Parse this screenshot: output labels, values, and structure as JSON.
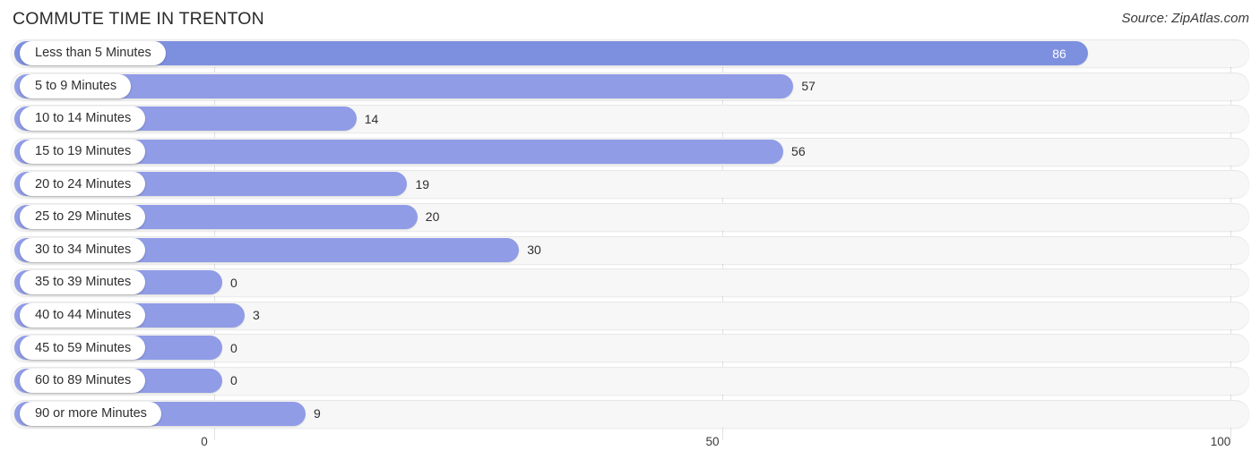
{
  "header": {
    "title": "COMMUTE TIME IN TRENTON",
    "source": "Source: ZipAtlas.com"
  },
  "colors": {
    "bar": "#909ce6",
    "bar_accent": "#7d8fdf",
    "track": "#f7f7f7",
    "gridline": "#e2e2e2",
    "text": "#2f2f2f"
  },
  "chart_data": {
    "type": "bar",
    "orientation": "horizontal",
    "title": "COMMUTE TIME IN TRENTON",
    "xlabel": "",
    "ylabel": "",
    "xlim": [
      0,
      100
    ],
    "ticks": [
      "0",
      "50",
      "100"
    ],
    "tick_values": [
      0,
      50,
      100
    ],
    "grid": true,
    "legend": null,
    "categories": [
      "Less than 5 Minutes",
      "5 to 9 Minutes",
      "10 to 14 Minutes",
      "15 to 19 Minutes",
      "20 to 24 Minutes",
      "25 to 29 Minutes",
      "30 to 34 Minutes",
      "35 to 39 Minutes",
      "40 to 44 Minutes",
      "45 to 59 Minutes",
      "60 to 89 Minutes",
      "90 or more Minutes"
    ],
    "values": [
      86,
      57,
      14,
      56,
      19,
      20,
      30,
      0,
      3,
      0,
      0,
      9
    ],
    "value_labels": [
      "86",
      "57",
      "14",
      "56",
      "19",
      "20",
      "30",
      "0",
      "3",
      "0",
      "0",
      "9"
    ]
  },
  "rows": [
    {
      "label": "Less than 5 Minutes",
      "value": 86,
      "value_label": "86",
      "inside": true
    },
    {
      "label": "5 to 9 Minutes",
      "value": 57,
      "value_label": "57",
      "inside": false
    },
    {
      "label": "10 to 14 Minutes",
      "value": 14,
      "value_label": "14",
      "inside": false
    },
    {
      "label": "15 to 19 Minutes",
      "value": 56,
      "value_label": "56",
      "inside": false
    },
    {
      "label": "20 to 24 Minutes",
      "value": 19,
      "value_label": "19",
      "inside": false
    },
    {
      "label": "25 to 29 Minutes",
      "value": 20,
      "value_label": "20",
      "inside": false
    },
    {
      "label": "30 to 34 Minutes",
      "value": 30,
      "value_label": "30",
      "inside": false
    },
    {
      "label": "35 to 39 Minutes",
      "value": 0,
      "value_label": "0",
      "inside": false
    },
    {
      "label": "40 to 44 Minutes",
      "value": 3,
      "value_label": "3",
      "inside": false
    },
    {
      "label": "45 to 59 Minutes",
      "value": 0,
      "value_label": "0",
      "inside": false
    },
    {
      "label": "60 to 89 Minutes",
      "value": 0,
      "value_label": "0",
      "inside": false
    },
    {
      "label": "90 or more Minutes",
      "value": 9,
      "value_label": "9",
      "inside": false
    }
  ],
  "axis": {
    "ticks": [
      {
        "label": "0",
        "value": 0
      },
      {
        "label": "50",
        "value": 50
      },
      {
        "label": "100",
        "value": 100
      }
    ]
  }
}
